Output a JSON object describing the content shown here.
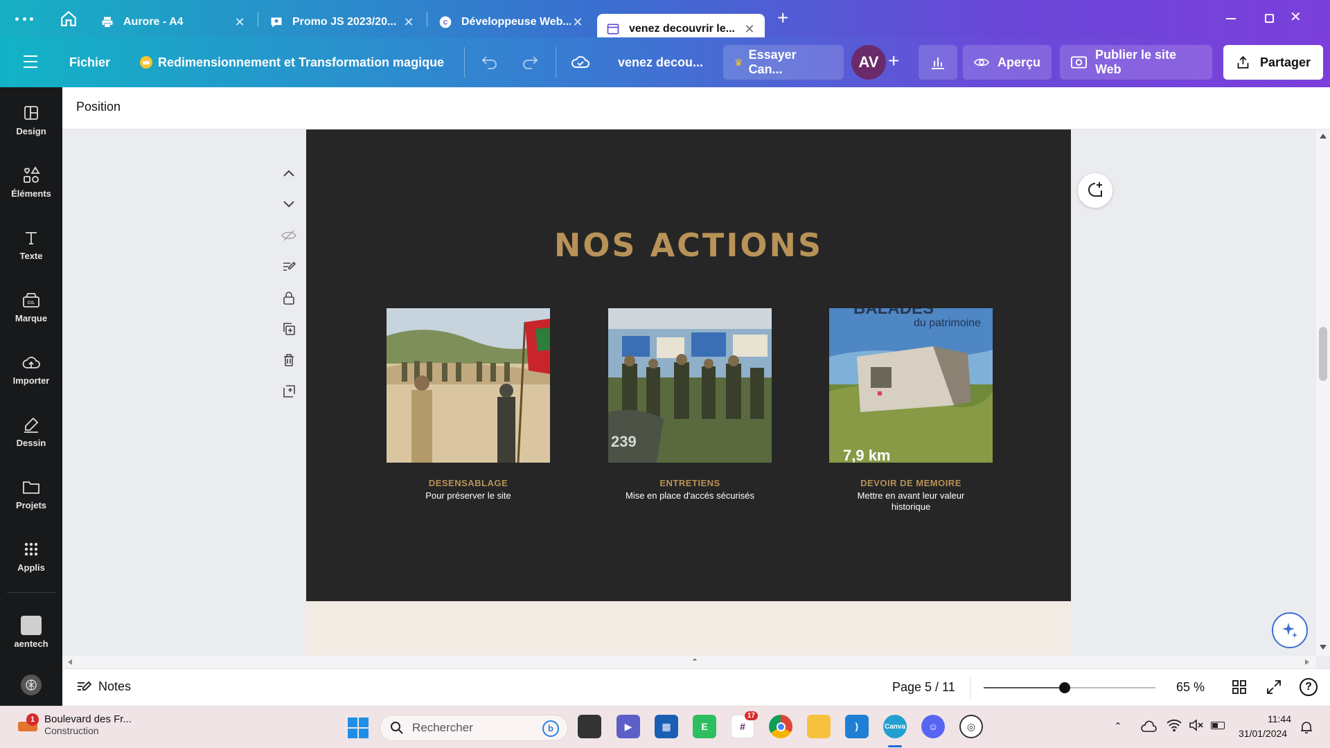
{
  "browser": {
    "tabs": [
      {
        "title": "Aurore - A4"
      },
      {
        "title": "Promo JS 2023/20..."
      },
      {
        "title": "Développeuse Web..."
      },
      {
        "title": "venez decouvrir le..."
      }
    ],
    "new_tab_symbol": "+"
  },
  "header": {
    "file_label": "Fichier",
    "magic_label": "Redimensionnement et Transformation magique",
    "doc_title": "venez decou...",
    "try_label": "Essayer Can...",
    "avatar_initials": "AV",
    "preview_label": "Aperçu",
    "publish_label": "Publier le site Web",
    "share_label": "Partager"
  },
  "rail": {
    "items": [
      "Design",
      "Éléments",
      "Texte",
      "Marque",
      "Importer",
      "Dessin",
      "Projets",
      "Applis",
      "aentech"
    ]
  },
  "toolbar": {
    "position_label": "Position"
  },
  "page": {
    "heading": "NOS ACTIONS",
    "cards": [
      {
        "title": "DESENSABLAGE",
        "text": "Pour préserver le site"
      },
      {
        "title": "ENTRETIENS",
        "text": "Mise en place d'accés sécurisés"
      },
      {
        "title": "DEVOIR DE MEMOIRE",
        "text": "Mettre en avant leur valeur historique"
      }
    ],
    "photo3_caption": "du patrimoine",
    "photo3_caption_top": "BALADES",
    "photo3_km": "7,9 km",
    "photo2_plate": "239"
  },
  "footer": {
    "notes_label": "Notes",
    "page_indicator": "Page 5 / 11",
    "zoom_label": "65 %",
    "zoom_fraction": 0.47
  },
  "taskbar": {
    "weather_title": "Boulevard des Fr...",
    "weather_sub": "Construction",
    "weather_badge": "1",
    "search_placeholder": "Rechercher",
    "badge_count": "17",
    "time": "11:44",
    "date": "31/01/2024"
  },
  "colors": {
    "accent_gold": "#b89257",
    "page_bg": "#262626",
    "avatar": "#6b2a6a"
  }
}
